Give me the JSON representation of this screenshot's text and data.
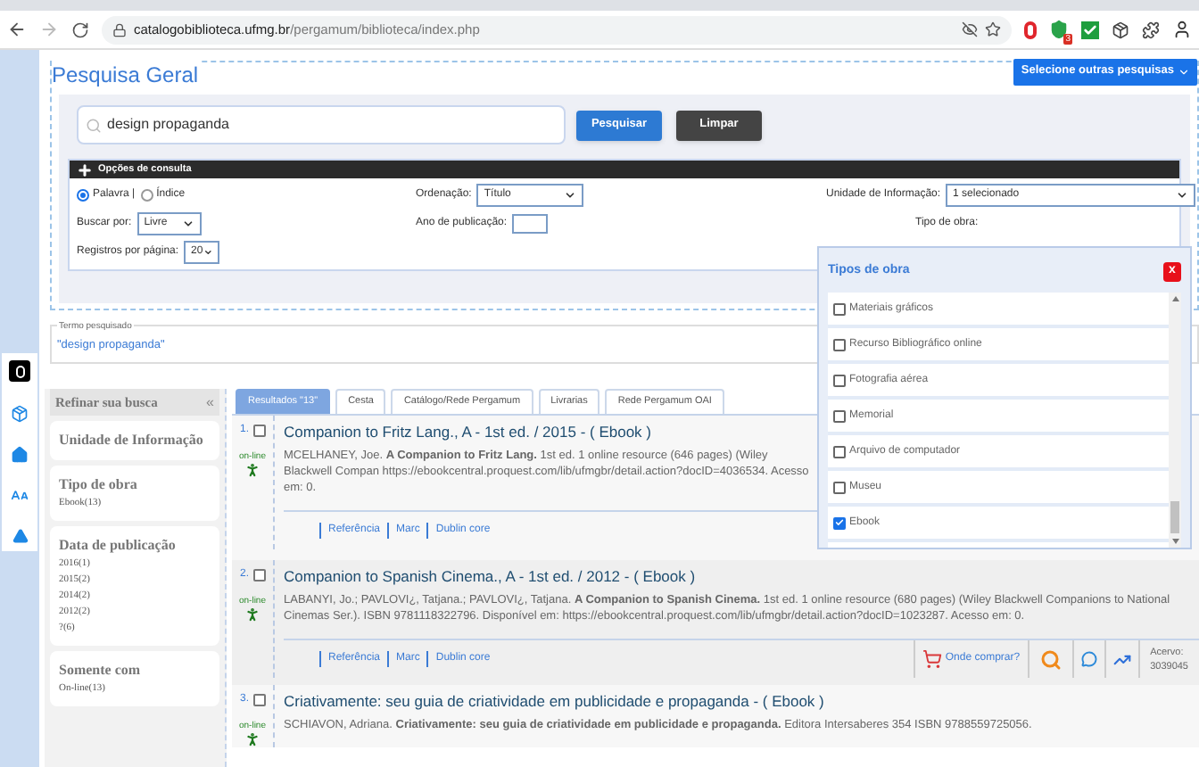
{
  "browser": {
    "url_domain": "catalogobiblioteca.ufmg.br",
    "url_path": "/pergamum/biblioteca/index.php",
    "extension_badge": "3"
  },
  "header": {
    "title": "Pesquisa Geral",
    "other_searches": "Selecione outras pesquisas"
  },
  "search": {
    "value": "design propaganda",
    "buttons": [
      "Pesquisar",
      "Limpar"
    ]
  },
  "options": {
    "title": "Opções de consulta",
    "modes": [
      {
        "label": "Palavra |",
        "selected": true
      },
      {
        "label": "Índice",
        "selected": false
      }
    ],
    "sort": {
      "label": "Ordenação:",
      "value": "Título"
    },
    "unit": {
      "label": "Unidade de Informação:",
      "value": "1 selecionado"
    },
    "search_by": {
      "label": "Buscar por:",
      "value": "Livre"
    },
    "year": {
      "label": "Ano de publicação:"
    },
    "work_type": {
      "label": "Tipo de obra:"
    },
    "per_page": {
      "label": "Registros por página:",
      "value": "20"
    }
  },
  "types_popup": {
    "title": "Tipos de obra",
    "close": "x",
    "items": [
      {
        "label": "Materiais gráficos",
        "checked": false
      },
      {
        "label": "Recurso Bibliográfico online",
        "checked": false
      },
      {
        "label": "Fotografia aérea",
        "checked": false
      },
      {
        "label": "Memorial",
        "checked": false
      },
      {
        "label": "Arquivo de computador",
        "checked": false
      },
      {
        "label": "Museu",
        "checked": false
      },
      {
        "label": "Ebook",
        "checked": true
      }
    ]
  },
  "searched_term": {
    "legend": "Termo pesquisado",
    "value": "\"design propaganda\""
  },
  "refine": {
    "title": "Refinar sua busca",
    "collapse": "«",
    "facets": [
      {
        "title": "Unidade de Informação"
      },
      {
        "title": "Tipo de obra",
        "values": [
          "Ebook(13)"
        ]
      },
      {
        "title": "Data de publicação",
        "values": [
          "2016(1)",
          "2015(2)",
          "2014(2)",
          "2012(2)",
          "?(6)"
        ]
      },
      {
        "title": "Somente com",
        "values": [
          "On-line(13)"
        ]
      }
    ]
  },
  "tabs": [
    {
      "label": "Resultados \"13\"",
      "selected": true
    },
    {
      "label": "Cesta",
      "selected": false
    },
    {
      "label": "Catálogo/Rede Pergamum",
      "selected": false
    },
    {
      "label": "Livrarias",
      "selected": false
    },
    {
      "label": "Rede Pergamum OAI",
      "selected": false
    }
  ],
  "results": [
    {
      "number": "1.",
      "checked": false,
      "title": "Companion to Fritz Lang., A - 1st ed. / 2015 -  ( Ebook )",
      "online": "on-line",
      "citation": "MCELHANEY, Joe. **A Companion to Fritz Lang.** 1st ed. 1 online resource (646 pages) (Wiley Blackwell Compan https://ebookcentral.proquest.com/lib/ufmgbr/detail.action?docID=4036534. Acesso em: 0.",
      "links": [
        "Referência",
        "Marc",
        "Dublin core"
      ]
    },
    {
      "number": "2.",
      "checked": false,
      "title": "Companion to Spanish Cinema., A - 1st ed. / 2012 -  ( Ebook )",
      "online": "on-line",
      "citation": "LABANYI, Jo.; PAVLOVI¿, Tatjana.; PAVLOVI¿, Tatjana. **A Companion to Spanish Cinema.** 1st ed. 1 online resource (680 pages) (Wiley Blackwell Companions to National Cinemas Ser.). ISBN 9781118322796. Disponível em: https://ebookcentral.proquest.com/lib/ufmgbr/detail.action?docID=1023287. Acesso em: 0.",
      "links": [
        "Referência",
        "Marc",
        "Dublin core"
      ],
      "buy": "Onde comprar?",
      "holdings_label": "Acervo:",
      "holdings_number": "3039045"
    },
    {
      "number": "3.",
      "checked": false,
      "title": "Criativamente: seu guia de criatividade em publicidade e propaganda  -  ( Ebook )",
      "online": "on-line",
      "citation": "SCHIAVON, Adriana. **Criativamente: seu guia de criatividade em publicidade e propaganda.** Editora Intersaberes 354 ISBN 9788559725056."
    }
  ]
}
